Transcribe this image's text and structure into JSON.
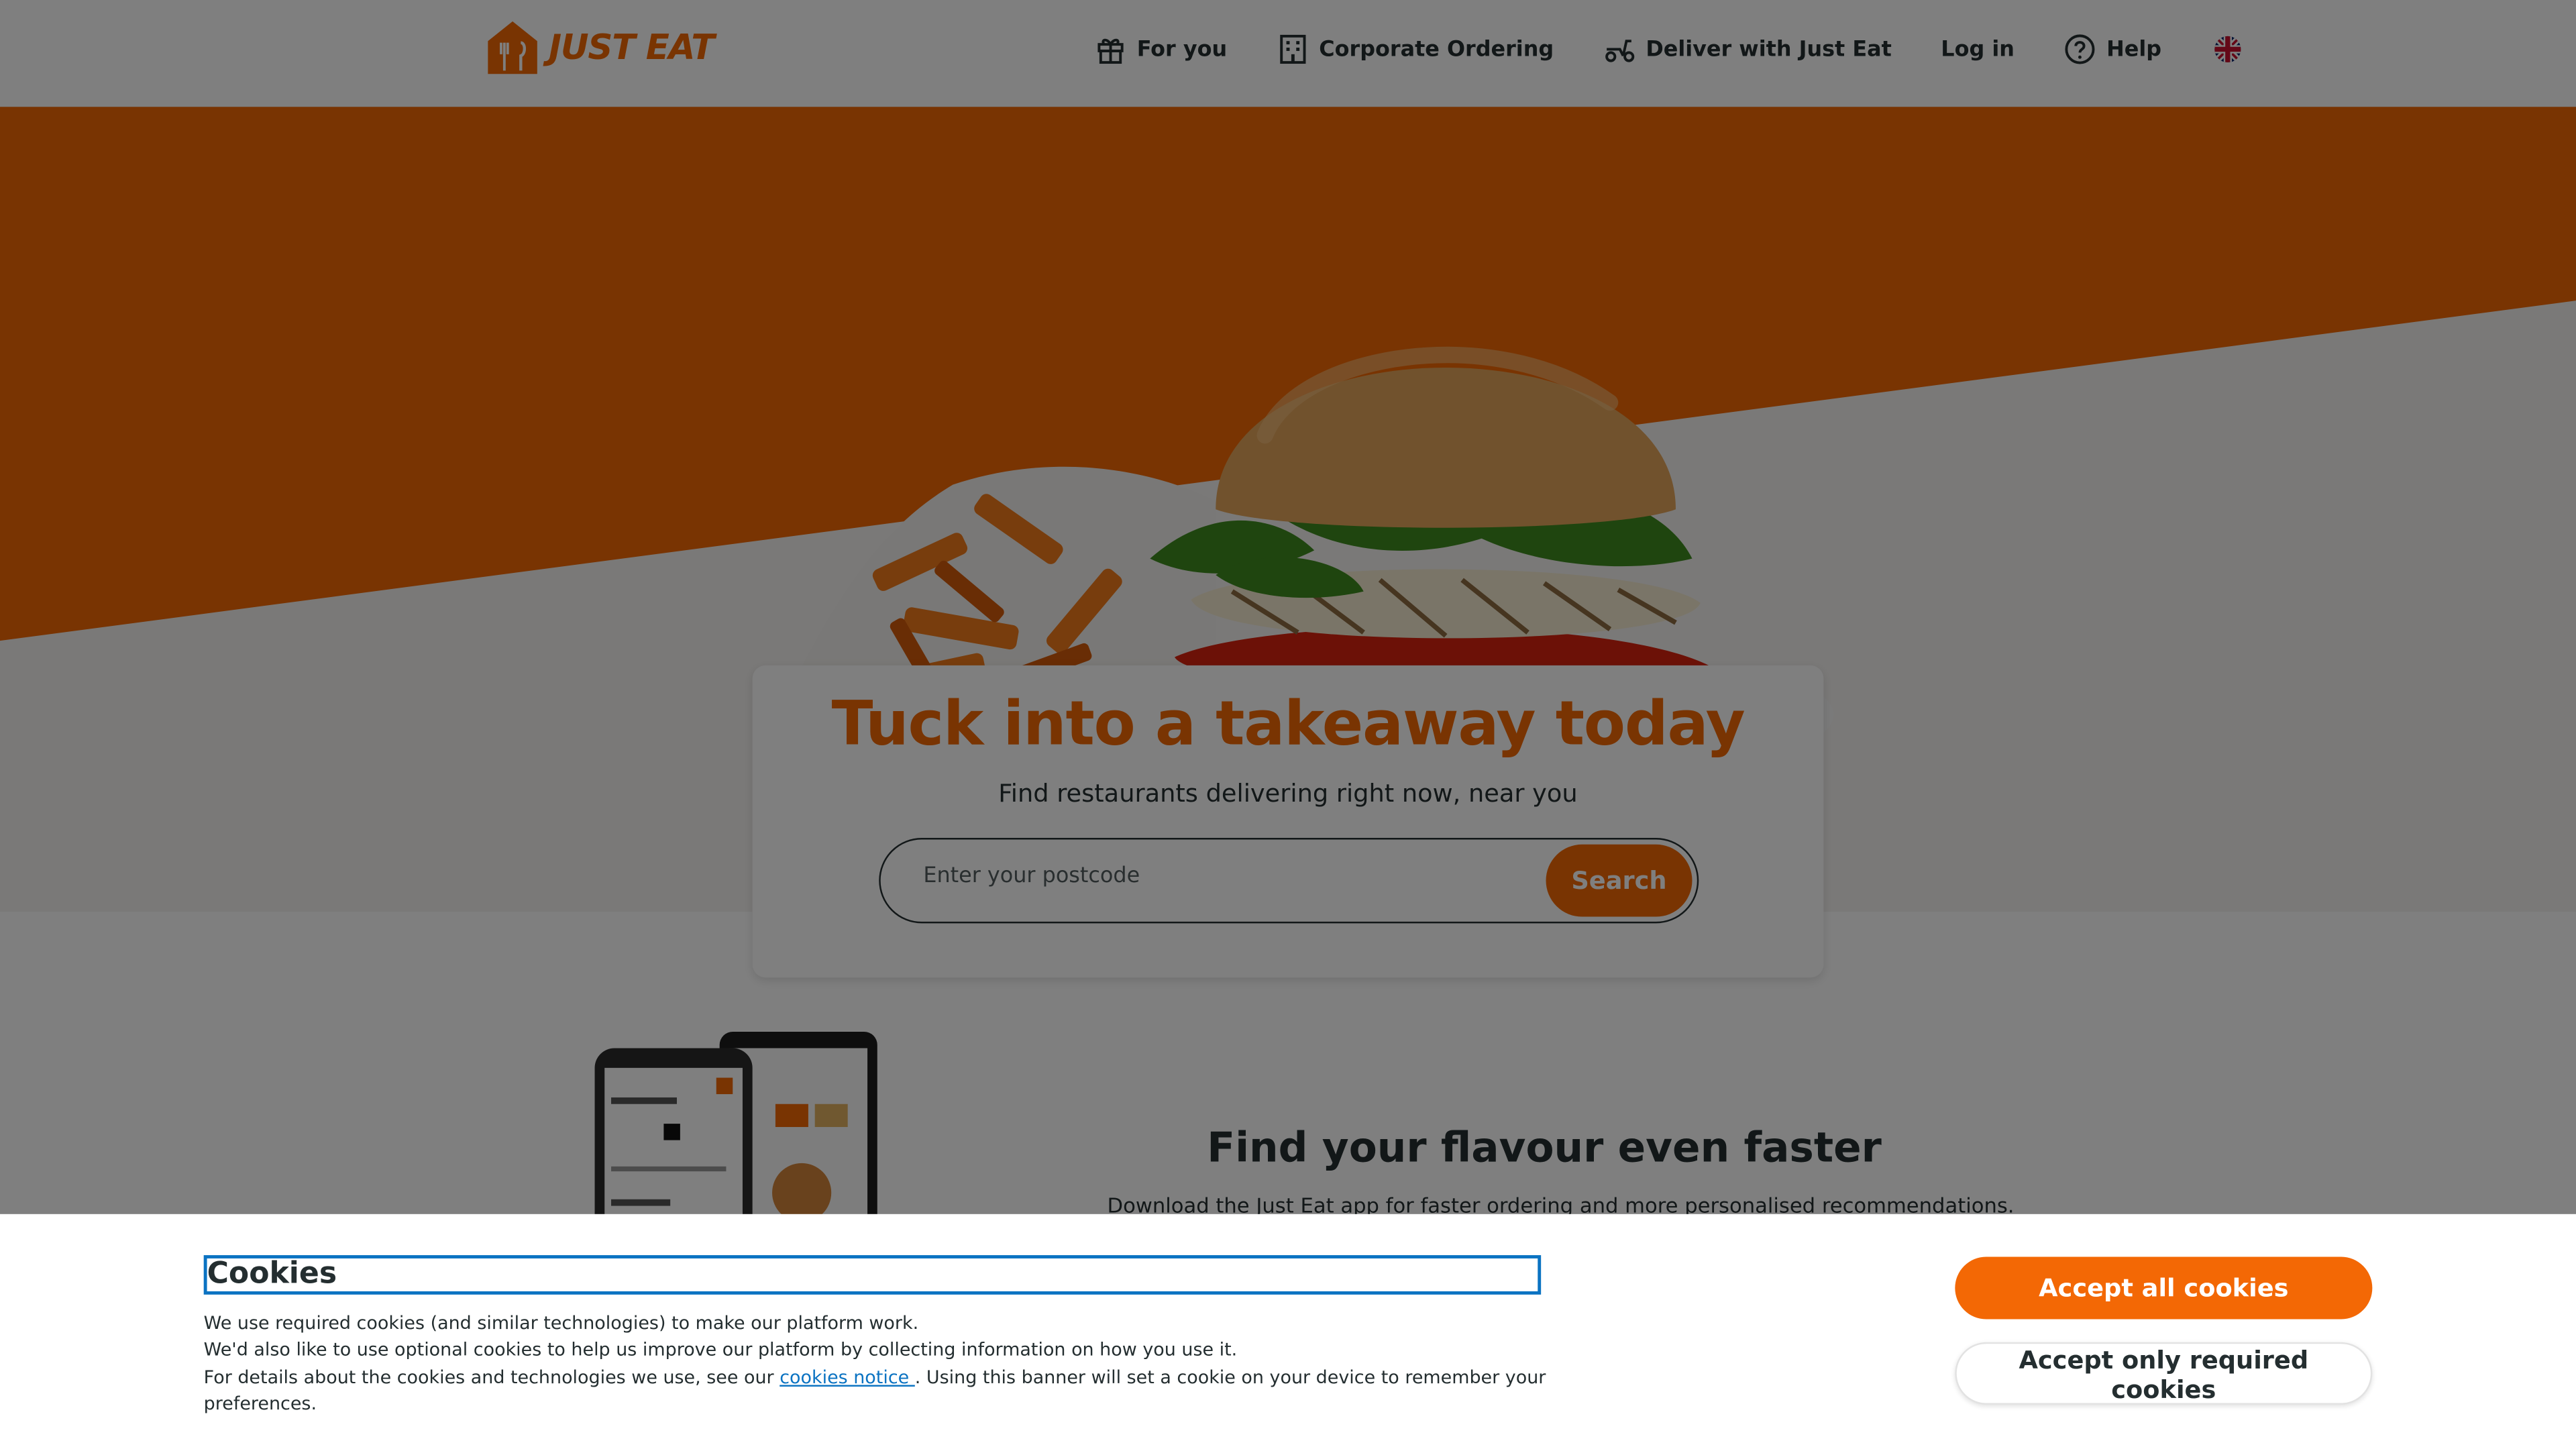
{
  "header": {
    "logo_text": "JUST EAT",
    "nav": [
      {
        "label": "For you",
        "icon": "gift-icon"
      },
      {
        "label": "Corporate Ordering",
        "icon": "building-icon"
      },
      {
        "label": "Deliver with Just Eat",
        "icon": "scooter-icon"
      },
      {
        "label": "Log in"
      },
      {
        "label": "Help",
        "icon": "help-icon"
      }
    ],
    "language_icon": "uk-flag-icon"
  },
  "hero": {
    "title": "Tuck into a takeaway today",
    "subtitle": "Find restaurants delivering right now, near you",
    "search": {
      "placeholder": "Enter your postcode",
      "value": "",
      "button_label": "Search"
    }
  },
  "app_promo": {
    "title": "Find your flavour even faster",
    "subtitle": "Download the Just Eat app for faster ordering and more personalised recommendations."
  },
  "cookie_banner": {
    "title": "Cookies",
    "line1": "We use required cookies (and similar technologies) to make our platform work.",
    "line2": "We'd also like to use optional cookies to help us improve our platform by collecting information on how you use it.",
    "line3_prefix": "For details about the cookies and technologies we use, see our ",
    "link_label": "cookies notice ",
    "line3_suffix": ". Using this banner will set a cookie on your device to remember your preferences.",
    "accept_all_label": "Accept all cookies",
    "accept_required_label": "Accept only required cookies"
  },
  "colors": {
    "brand_orange": "#f36805",
    "text_dark": "#242e30",
    "focus_blue": "#0b73c2"
  }
}
